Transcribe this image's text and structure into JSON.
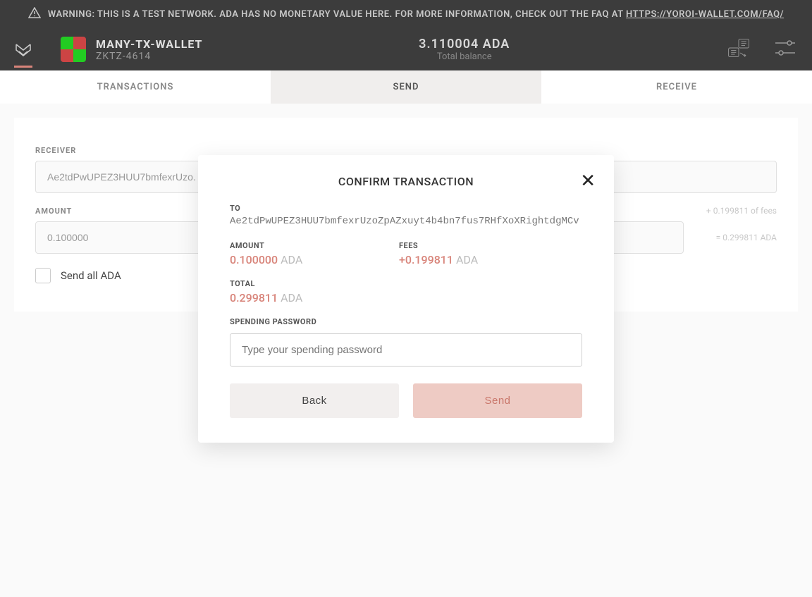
{
  "warning": {
    "text": "WARNING: THIS IS A TEST NETWORK. ADA HAS NO MONETARY VALUE HERE. FOR MORE INFORMATION, CHECK OUT THE FAQ AT ",
    "link": "HTTPS://YOROI-WALLET.COM/FAQ/"
  },
  "wallet": {
    "name": "MANY-TX-WALLET",
    "id": "ZKTZ-4614",
    "balance": "3.110004 ADA",
    "balance_label": "Total balance"
  },
  "tabs": {
    "transactions": "TRANSACTIONS",
    "send": "SEND",
    "receive": "RECEIVE"
  },
  "form": {
    "receiver_label": "RECEIVER",
    "receiver_value": "Ae2tdPwUPEZ3HUU7bmfexrUzo.",
    "amount_label": "AMOUNT",
    "amount_value": "0.100000",
    "fee_hint": "+ 0.199811 of fees",
    "total_hint": "= 0.299811 ADA",
    "send_all_label": "Send all ADA"
  },
  "modal": {
    "title": "CONFIRM TRANSACTION",
    "to_label": "TO",
    "to_address": "Ae2tdPwUPEZ3HUU7bmfexrUzoZpAZxuyt4b4bn7fus7RHfXoXRightdgMCv",
    "amount_label": "AMOUNT",
    "amount_value": "0.100000",
    "amount_unit": "ADA",
    "fees_label": "FEES",
    "fees_value": "+0.199811",
    "fees_unit": "ADA",
    "total_label": "TOTAL",
    "total_value": "0.299811",
    "total_unit": "ADA",
    "password_label": "SPENDING PASSWORD",
    "password_placeholder": "Type your spending password",
    "back_label": "Back",
    "send_label": "Send"
  }
}
